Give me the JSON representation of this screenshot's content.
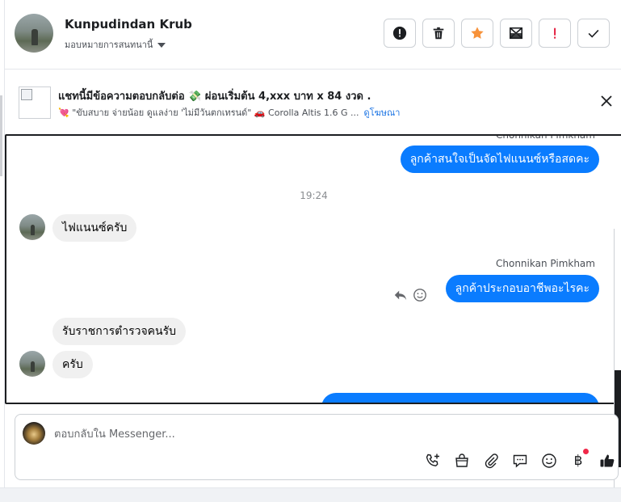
{
  "contact": {
    "name": "Kunpudindan Krub",
    "assign_label": "มอบหมายการสนทนานี้"
  },
  "toolbar": {
    "actions": [
      "spam-icon",
      "trash-icon",
      "star-icon",
      "envelope-icon",
      "exclamation-icon",
      "check-icon"
    ],
    "colors": {
      "star": "#f7923a",
      "alert": "#e41e3f"
    }
  },
  "ad": {
    "title": "แชทนี้มีข้อความตอบกลับต่อ 💸 ผ่อนเริ่มต้น 4,xxx บาท x 84 งวด .",
    "subtitle": "💘 \"ขับสบาย จ่ายน้อย ดูแลง่าย 'ไม่มีวันตกเทรนด์\" 🚗 Corolla Altis 1.6 G ...",
    "link": "ดูโฆษณา"
  },
  "chat": {
    "sender_top": "Chonnikan Pimkham",
    "msg1": "ลูกค้าสนใจเป็นจัดไฟแนนซ์หรือสดคะ",
    "time": "19:24",
    "msg2": "ไฟแนนซ์ครับ",
    "sender_mid": "Chonnikan Pimkham",
    "msg3": "ลูกค้าประกอบอาชีพอะไรคะ",
    "msg4": "รับราชการตำรวจคนรับ",
    "msg5": "ครับ"
  },
  "composer": {
    "placeholder": "ตอบกลับใน Messenger...",
    "tools": [
      "phone-add-icon",
      "bag-icon",
      "paperclip-icon",
      "comment-icon",
      "emoji-icon",
      "baht-icon",
      "thumbs-up-icon"
    ],
    "baht_symbol": "฿",
    "colors": {
      "accent": "#0a7cff"
    }
  }
}
